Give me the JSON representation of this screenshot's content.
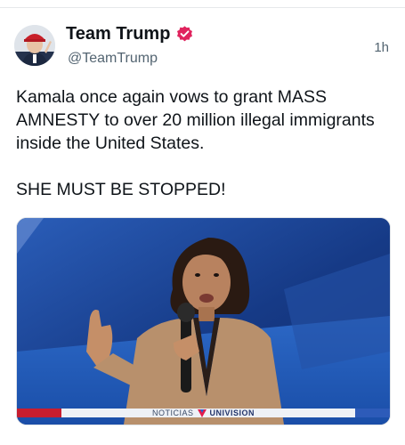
{
  "post": {
    "display_name": "Team Trump",
    "handle": "@TeamTrump",
    "timestamp": "1h",
    "verified_icon": "verified-badge-icon",
    "text_line1": "Kamala once again vows to grant MASS AMNESTY to over 20 million illegal immigrants inside the United States.",
    "text_line2": "SHE MUST BE STOPPED!"
  },
  "media": {
    "lower_third_left": "NOTICIAS",
    "lower_third_brand": "UNIVISION"
  },
  "colors": {
    "verified": "#e0245e",
    "media_background": "#1d3f8a"
  }
}
